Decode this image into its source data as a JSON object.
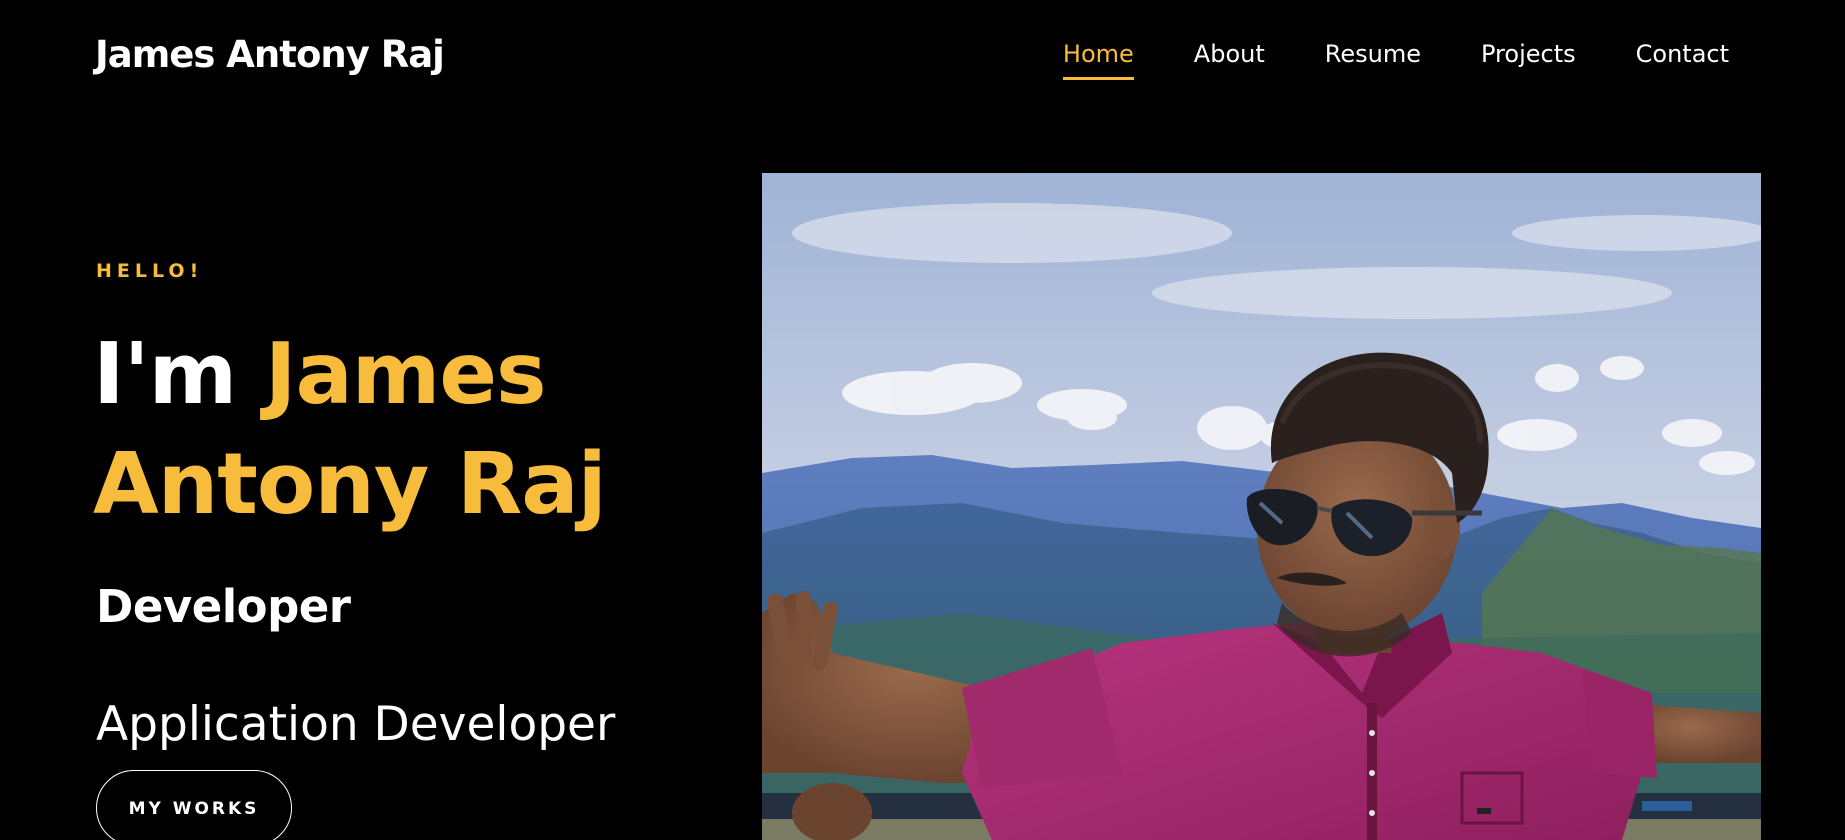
{
  "header": {
    "brand": "James Antony Raj",
    "nav": [
      {
        "label": "Home",
        "active": true
      },
      {
        "label": "About",
        "active": false
      },
      {
        "label": "Resume",
        "active": false
      },
      {
        "label": "Projects",
        "active": false
      },
      {
        "label": "Contact",
        "active": false
      }
    ]
  },
  "hero": {
    "greeting": "HELLO!",
    "intro": "I'm",
    "name_line1": "James",
    "name_line2": "Antony Raj",
    "role": "Developer",
    "subrole": "Application Developer",
    "cta_label": "MY WORKS"
  },
  "colors": {
    "background": "#000000",
    "accent": "#f7bc3c",
    "text": "#ffffff"
  }
}
